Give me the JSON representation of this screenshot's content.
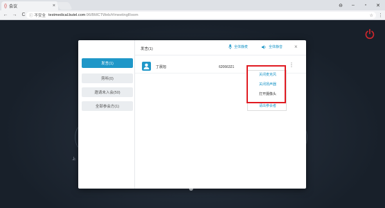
{
  "browser": {
    "tab_title": "会议",
    "tab_favicon": "{}",
    "address_security": "不安全",
    "address_host": "testmedical.butel.com",
    "address_path": ":96/BMCTWeb/#/meetingRoom",
    "icons": [
      "back-icon",
      "forward-icon",
      "reload-icon",
      "info-icon",
      "star-icon",
      "menu-dots-icon"
    ]
  },
  "background": {
    "partial_label": "上",
    "power_color": "#d6272d"
  },
  "modal": {
    "side_tabs": [
      {
        "label": "发言(1)",
        "active": true
      },
      {
        "label": "旁听(0)",
        "active": false
      },
      {
        "label": "邀请未入会(50)",
        "active": false
      },
      {
        "label": "全部参会方(1)",
        "active": false
      }
    ],
    "header": {
      "title": "发言(1)",
      "mute_mic_label": "全体静麦",
      "mute_speaker_label": "全体静音",
      "close": "×"
    },
    "participant": {
      "name": "丁晨旭",
      "id": "62066321",
      "more": "⋮"
    }
  },
  "context_menu": {
    "items": [
      "关闭麦克风",
      "关闭扬声器",
      "打开摄像头",
      "请出参会者"
    ],
    "highlight_color": "#e01b22"
  },
  "colors": {
    "accent": "#1f97c8",
    "background": "#1b2430"
  }
}
